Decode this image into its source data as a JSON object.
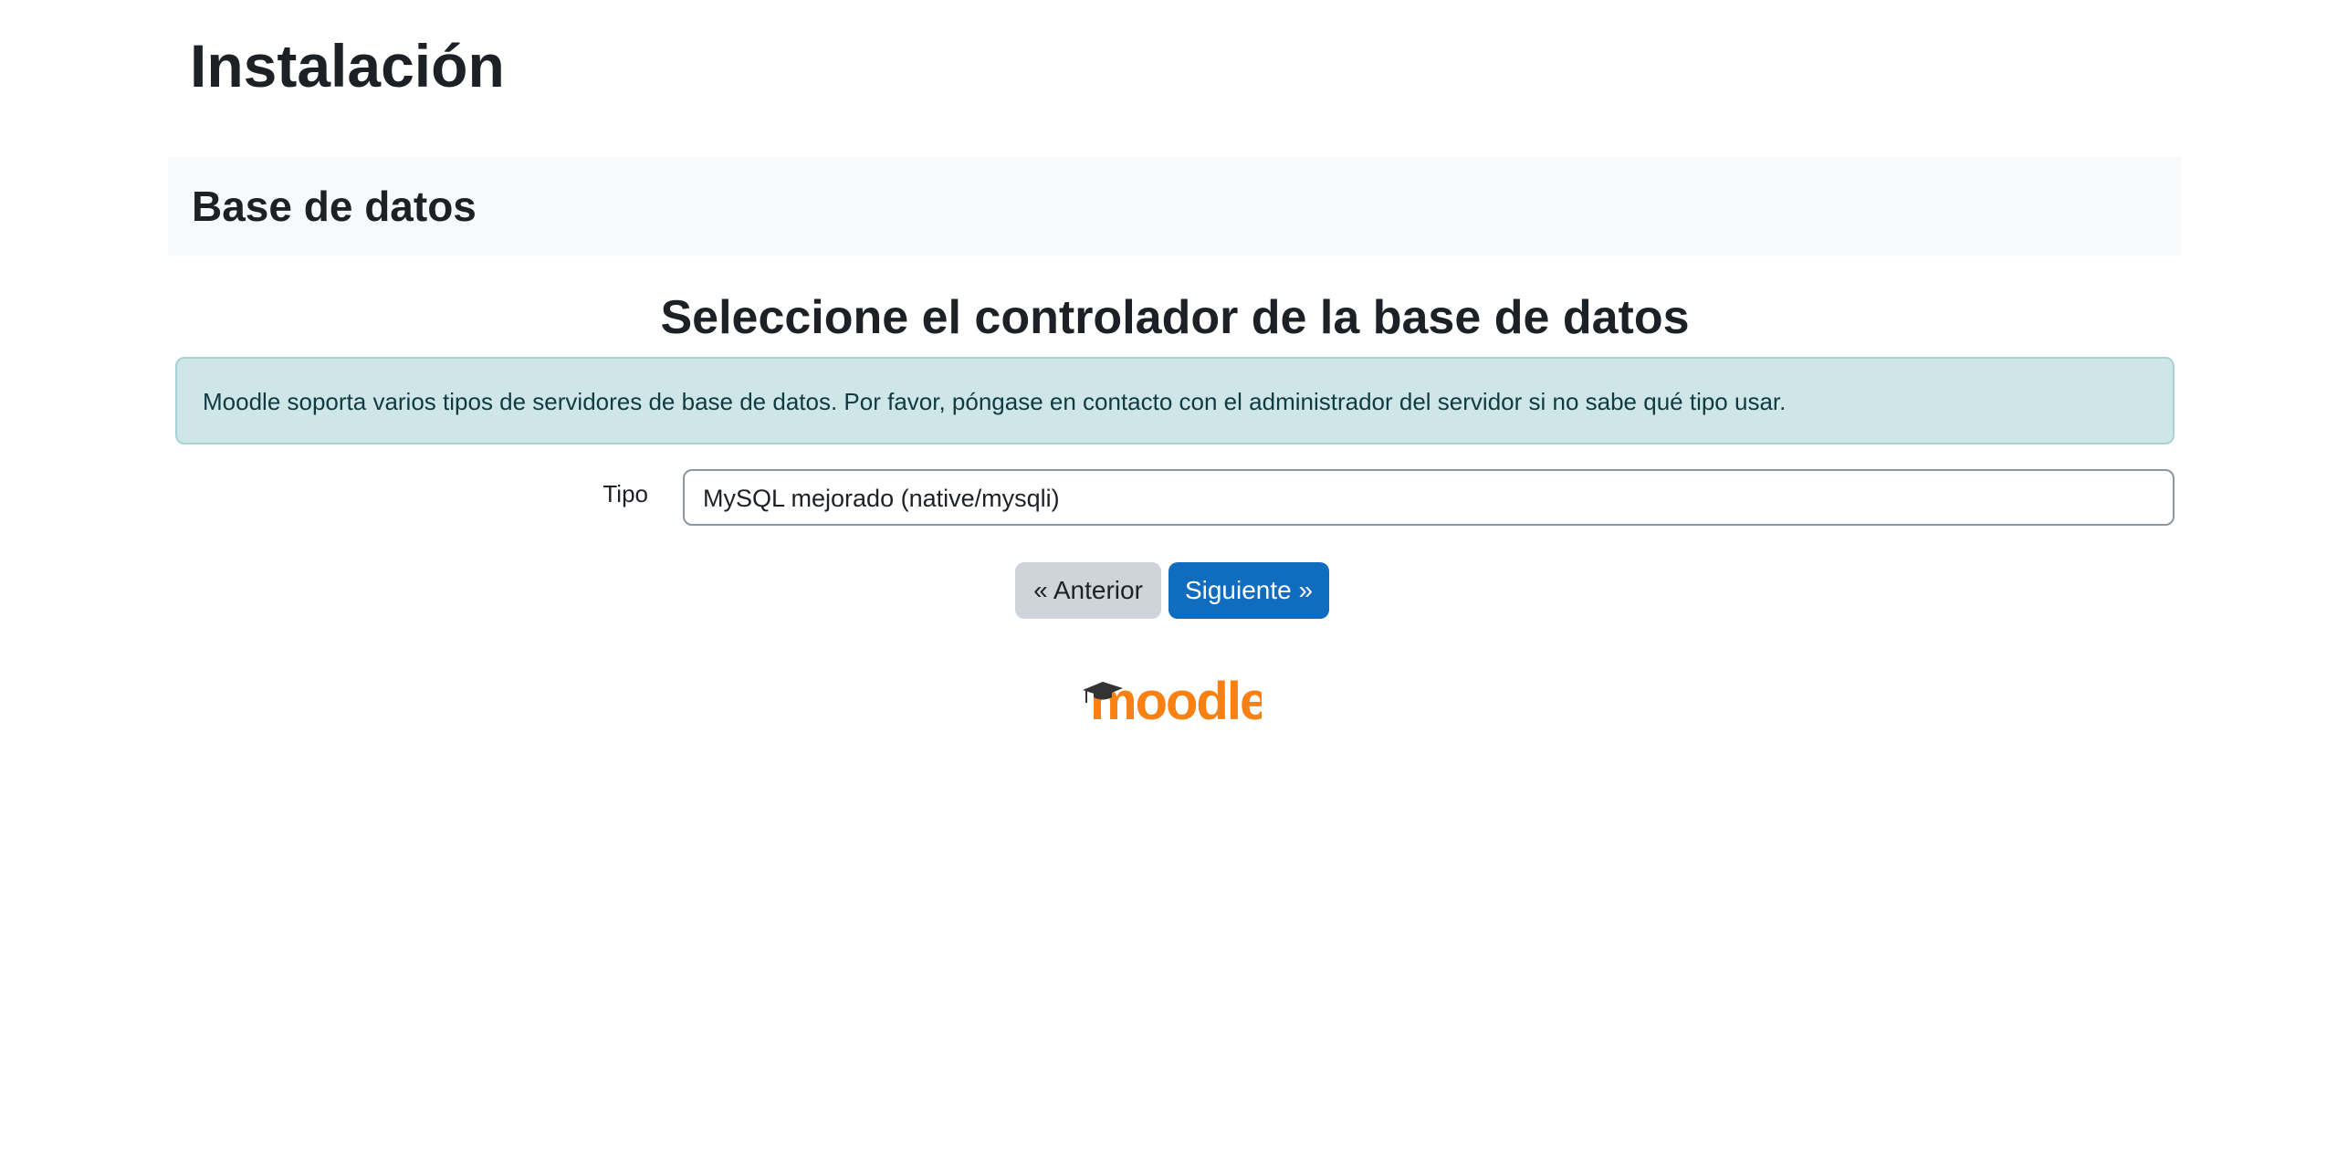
{
  "page": {
    "title": "Instalación"
  },
  "section": {
    "title": "Base de datos"
  },
  "main": {
    "heading": "Seleccione el controlador de la base de datos",
    "info_message": "Moodle soporta varios tipos de servidores de base de datos. Por favor, póngase en contacto con el administrador del servidor si no sabe qué tipo usar."
  },
  "form": {
    "type_label": "Tipo",
    "type_value": "MySQL mejorado (native/mysqli)"
  },
  "buttons": {
    "previous_label": "« Anterior",
    "next_label": "Siguiente »"
  },
  "footer": {
    "logo_text": "moodle",
    "logo_icon": "graduation-cap-icon"
  },
  "colors": {
    "primary": "#0f6cbf",
    "secondary": "#ced4da",
    "info_bg": "#cfe6e9",
    "info_border": "#a9d2d7",
    "header_bg": "#f8f9fa",
    "moodle_orange": "#f98012"
  }
}
